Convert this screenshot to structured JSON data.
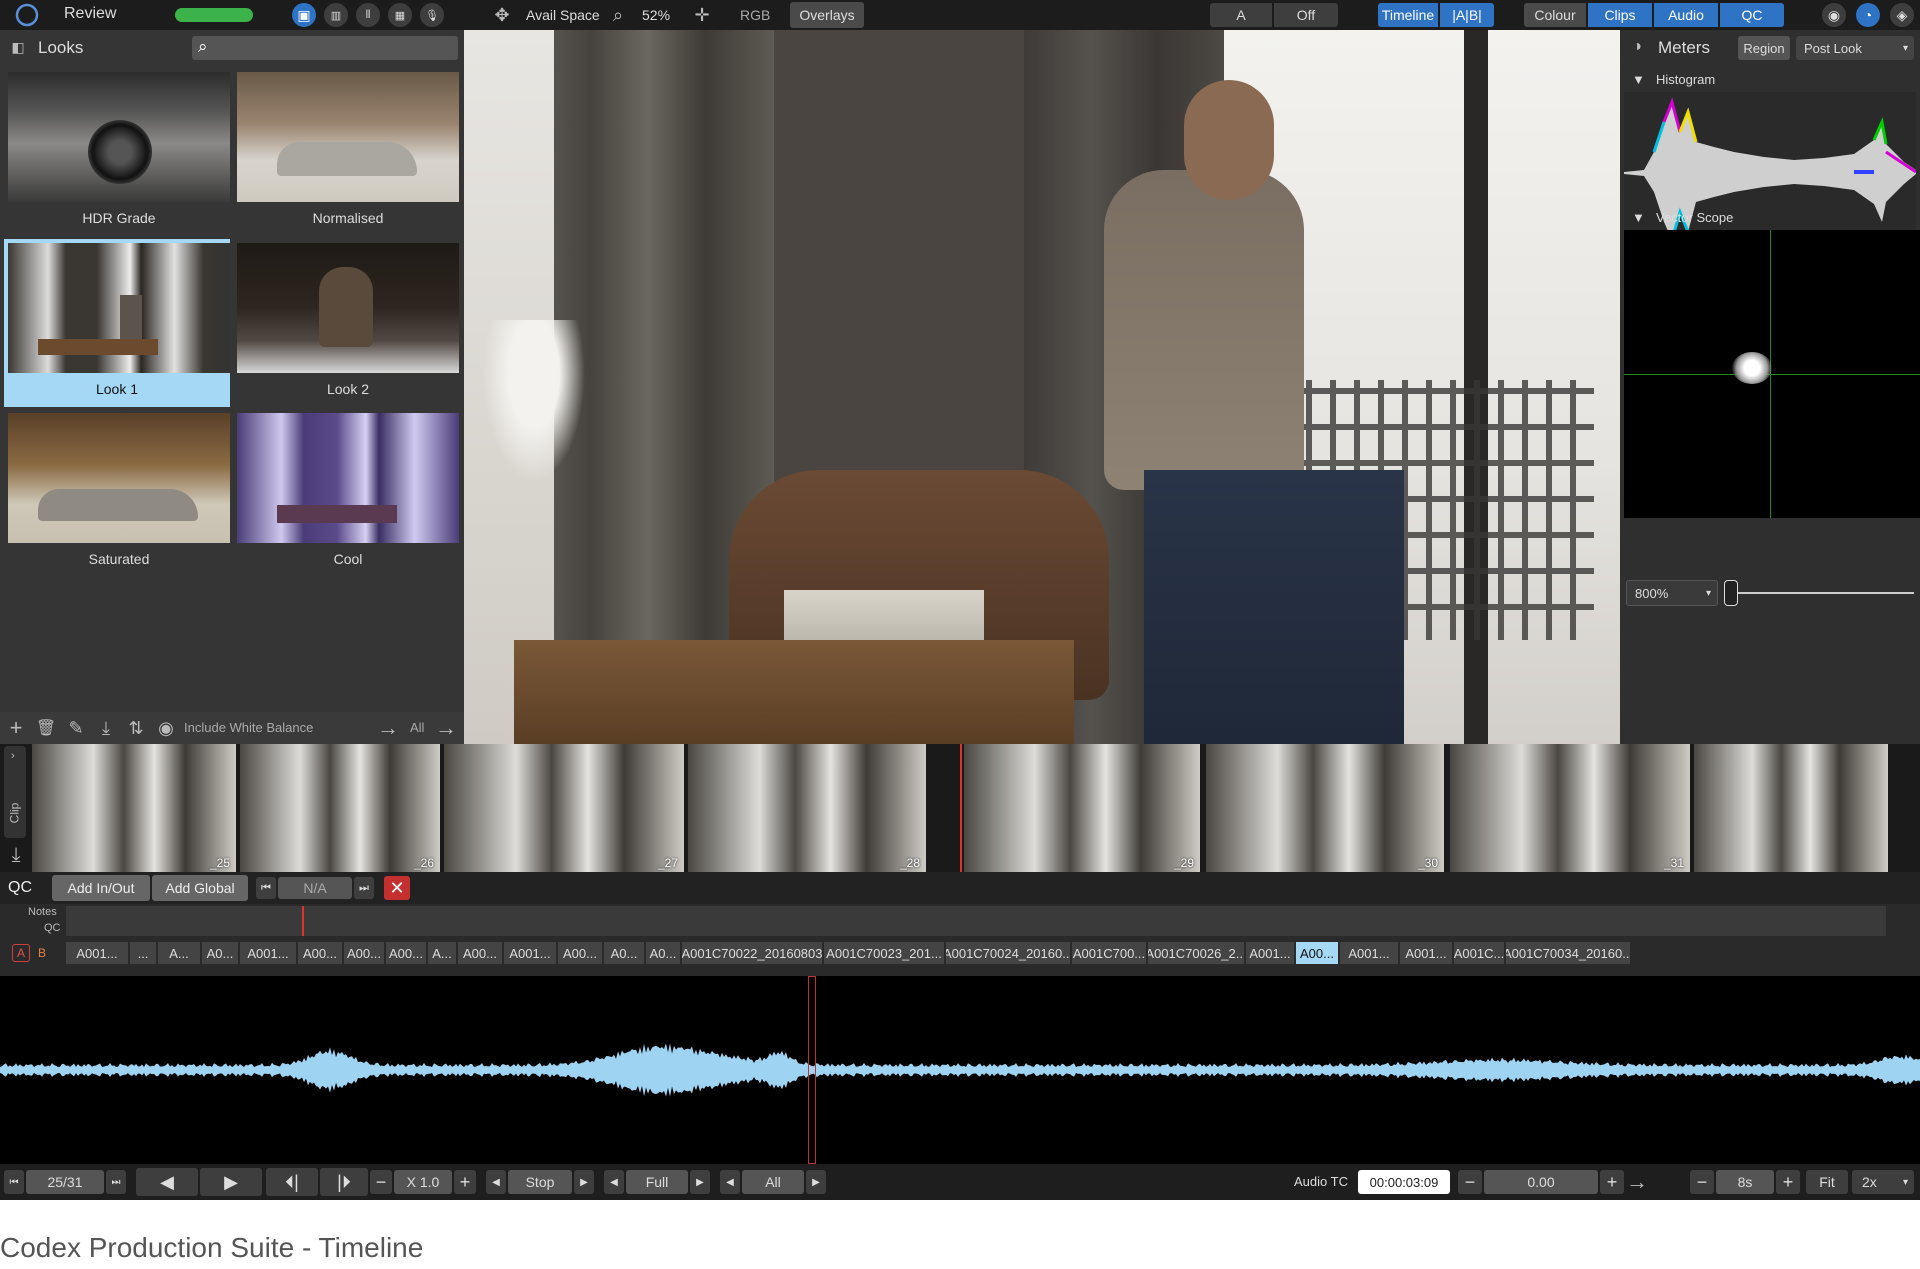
{
  "topbar": {
    "app_title": "Review",
    "avail_space_label": "Avail Space",
    "zoom_label": "52%",
    "rgb_label": "RGB",
    "overlays_label": "Overlays",
    "a_label": "A",
    "off_label": "Off",
    "timeline_label": "Timeline",
    "ab_label": "|A|B|",
    "colour_label": "Colour",
    "clips_label": "Clips",
    "audio_label": "Audio",
    "qc_label": "QC"
  },
  "looks": {
    "title": "Looks",
    "items": [
      {
        "label": "HDR Grade",
        "selected": false
      },
      {
        "label": "Normalised",
        "selected": false
      },
      {
        "label": "Look 1",
        "selected": true
      },
      {
        "label": "Look 2",
        "selected": false
      },
      {
        "label": "Saturated",
        "selected": false
      },
      {
        "label": "Cool",
        "selected": false
      }
    ],
    "include_wb_label": "Include White Balance",
    "all_label": "All"
  },
  "meters": {
    "title": "Meters",
    "region_label": "Region",
    "post_look_label": "Post Look",
    "histogram_label": "Histogram",
    "vectorscope_label": "Vector Scope",
    "zoom_value": "800%"
  },
  "filmstrip": {
    "side_label": "Clip",
    "frames": [
      "_25",
      "_26",
      "_27",
      "_28",
      "_29",
      "_30",
      "_31"
    ]
  },
  "qc": {
    "label": "QC",
    "add_in_out_label": "Add In/Out",
    "add_global_label": "Add Global",
    "nav_value": "N/A",
    "notes_label": "Notes",
    "qc_row_label": "QC",
    "a_label": "A",
    "b_label": "B",
    "clips": [
      {
        "label": "A001...",
        "selected": false
      },
      {
        "label": "...",
        "selected": false
      },
      {
        "label": "A...",
        "selected": false
      },
      {
        "label": "A0...",
        "selected": false
      },
      {
        "label": "A001...",
        "selected": false
      },
      {
        "label": "A00...",
        "selected": false
      },
      {
        "label": "A00...",
        "selected": false
      },
      {
        "label": "A00...",
        "selected": false
      },
      {
        "label": "A...",
        "selected": false
      },
      {
        "label": "A00...",
        "selected": false
      },
      {
        "label": "A001...",
        "selected": false
      },
      {
        "label": "A00...",
        "selected": false
      },
      {
        "label": "A0...",
        "selected": false
      },
      {
        "label": "A0...",
        "selected": false
      },
      {
        "label": "A001C70022_20160803",
        "selected": false
      },
      {
        "label": "A001C70023_201...",
        "selected": false
      },
      {
        "label": "A001C70024_20160...",
        "selected": false
      },
      {
        "label": "A001C700...",
        "selected": false
      },
      {
        "label": "A001C70026_2...",
        "selected": false
      },
      {
        "label": "A001...",
        "selected": false
      },
      {
        "label": "A00...",
        "selected": true
      },
      {
        "label": "A001...",
        "selected": false
      },
      {
        "label": "A001...",
        "selected": false
      },
      {
        "label": "A001C...",
        "selected": false
      },
      {
        "label": "A001C70034_20160...",
        "selected": false
      }
    ]
  },
  "transport": {
    "frame_counter": "25/31",
    "speed": "X 1.0",
    "stop_label": "Stop",
    "full_label": "Full",
    "all_label": "All",
    "audio_tc_label": "Audio TC",
    "audio_tc_value": "00:00:03:09",
    "offset_value": "0.00",
    "duration_value": "8s",
    "fit_label": "Fit",
    "zoom_value": "2x"
  },
  "caption": "Codex Production Suite  - Timeline"
}
